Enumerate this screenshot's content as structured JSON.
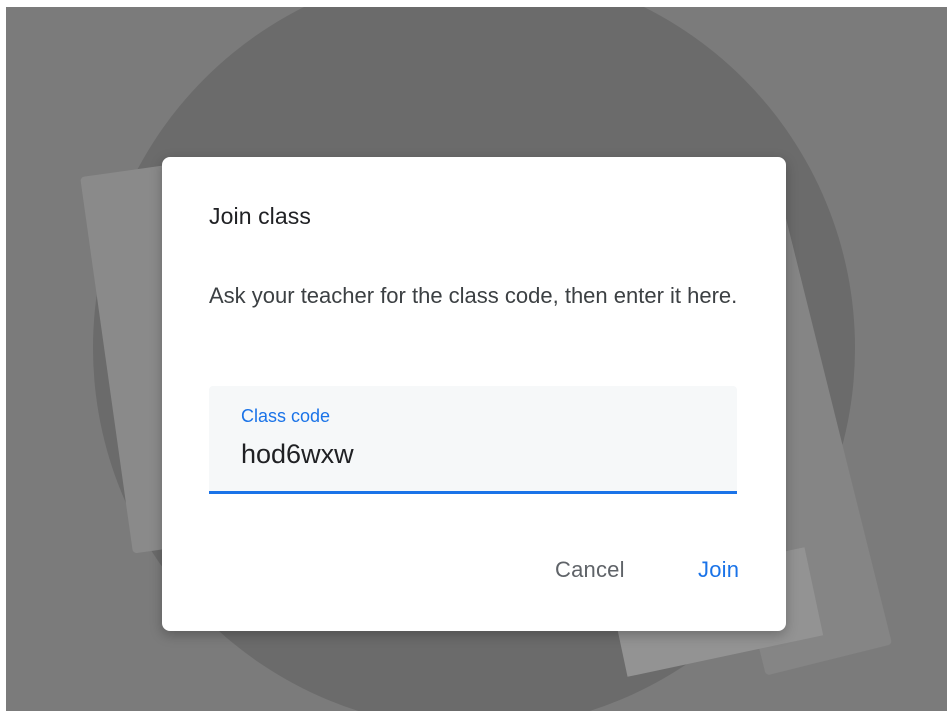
{
  "dialog": {
    "title": "Join class",
    "description": "Ask your teacher for the class code, then enter it here.",
    "field": {
      "label": "Class code",
      "value": "hod6wxw"
    },
    "actions": {
      "cancel_label": "Cancel",
      "join_label": "Join"
    }
  },
  "colors": {
    "accent": "#1a73e8",
    "scrim": "#7b7b7b",
    "dialog_bg": "#ffffff",
    "field_bg": "#f6f8f9"
  }
}
